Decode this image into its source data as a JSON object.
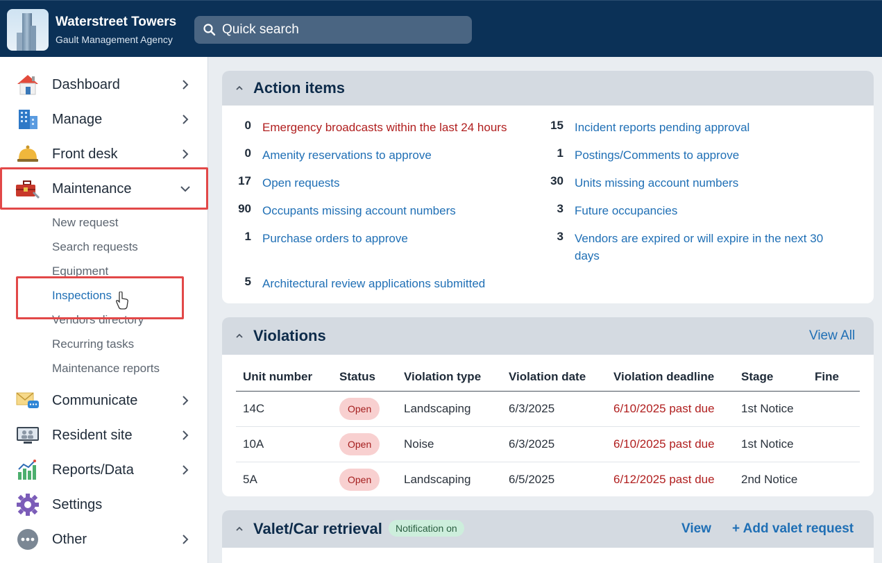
{
  "brand": {
    "title": "Waterstreet Towers",
    "subtitle": "Gault Management Agency"
  },
  "search": {
    "placeholder": "Quick search"
  },
  "sidebar": {
    "items": [
      {
        "label": "Dashboard",
        "icon": "house-icon"
      },
      {
        "label": "Manage",
        "icon": "building-icon"
      },
      {
        "label": "Front desk",
        "icon": "bell-icon"
      },
      {
        "label": "Maintenance",
        "icon": "toolbox-icon"
      },
      {
        "label": "Communicate",
        "icon": "mail-chat-icon"
      },
      {
        "label": "Resident site",
        "icon": "monitor-users-icon"
      },
      {
        "label": "Reports/Data",
        "icon": "bar-chart-icon"
      },
      {
        "label": "Settings",
        "icon": "gear-icon"
      },
      {
        "label": "Other",
        "icon": "more-icon"
      }
    ],
    "maintenance_sub": [
      "New request",
      "Search requests",
      "Equipment",
      "Inspections",
      "Vendors directory",
      "Recurring tasks",
      "Maintenance reports"
    ]
  },
  "action_items": {
    "title": "Action items",
    "left": [
      {
        "count": "0",
        "text": "Emergency broadcasts within the last 24 hours"
      },
      {
        "count": "0",
        "text": "Amenity reservations to approve"
      },
      {
        "count": "17",
        "text": "Open requests"
      },
      {
        "count": "90",
        "text": "Occupants missing account numbers"
      },
      {
        "count": "1",
        "text": "Purchase orders to approve"
      },
      {
        "count": "5",
        "text": "Architectural review applications submitted"
      }
    ],
    "right": [
      {
        "count": "15",
        "text": "Incident reports pending approval"
      },
      {
        "count": "1",
        "text": "Postings/Comments to approve"
      },
      {
        "count": "30",
        "text": "Units missing account numbers"
      },
      {
        "count": "3",
        "text": "Future occupancies"
      },
      {
        "count": "3",
        "text": "Vendors are expired or will expire in the next 30"
      },
      {
        "count": "",
        "text": "days"
      }
    ]
  },
  "violations": {
    "title": "Violations",
    "view_all": "View All",
    "columns": [
      "Unit number",
      "Status",
      "Violation type",
      "Violation date",
      "Violation deadline",
      "Stage",
      "Fine"
    ],
    "rows": [
      {
        "unit": "14C",
        "status": "Open",
        "type": "Landscaping",
        "date": "6/3/2025",
        "deadline": "6/10/2025 past due",
        "stage": "1st Notice",
        "fine": ""
      },
      {
        "unit": "10A",
        "status": "Open",
        "type": "Noise",
        "date": "6/3/2025",
        "deadline": "6/10/2025 past due",
        "stage": "1st Notice",
        "fine": ""
      },
      {
        "unit": "5A",
        "status": "Open",
        "type": "Landscaping",
        "date": "6/5/2025",
        "deadline": "6/12/2025 past due",
        "stage": "2nd Notice",
        "fine": ""
      }
    ]
  },
  "valet": {
    "title": "Valet/Car retrieval",
    "badge": "Notification on",
    "view": "View",
    "add": "+ Add valet request"
  },
  "colors": {
    "header": "#0b3157",
    "link": "#1f6fb5",
    "urgent": "#b01e1e",
    "highlight": "#e24848"
  }
}
